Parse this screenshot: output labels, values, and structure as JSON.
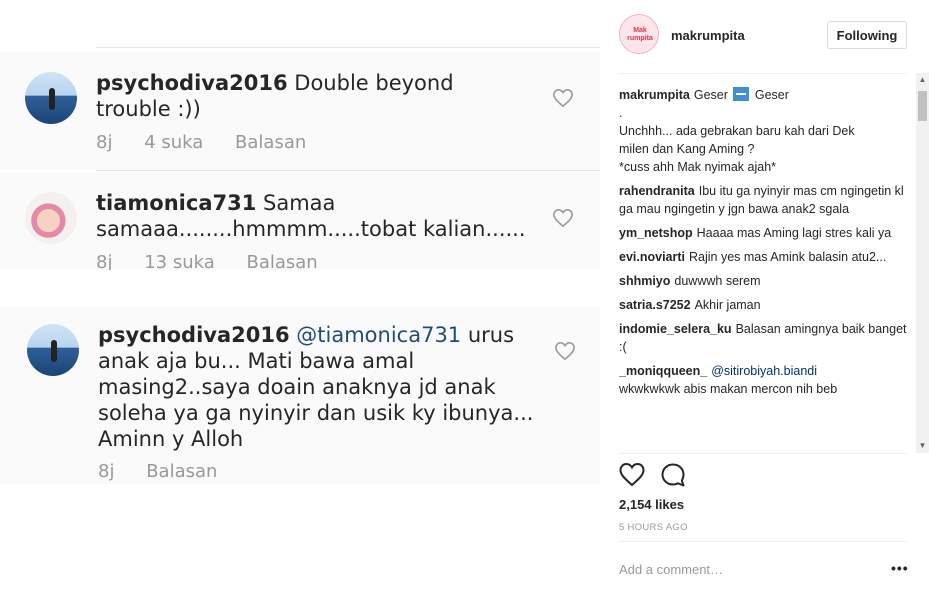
{
  "image_comments": [
    {
      "username": "psychodiva2016",
      "text_line1": "Double beyond",
      "text_line2": "trouble :))",
      "time": "8j",
      "likes": "4 suka",
      "reply": "Balasan"
    },
    {
      "username": "tiamonica731",
      "text_line1": "Samaa",
      "text_line2": "samaaa........hmmmm.....tobat kalian......",
      "time": "8j",
      "likes": "13 suka",
      "reply": "Balasan"
    },
    {
      "username": "psychodiva2016",
      "mention": "@tiamonica731",
      "text_line1": "urus",
      "text_line2": "anak aja bu... Mati bawa amal",
      "text_line3": "masing2..saya doain anaknya jd anak",
      "text_line4": "soleha ya ga nyinyir dan usik ky ibunya...",
      "text_line5": "Aminn y Alloh",
      "time": "8j",
      "reply": "Balasan"
    }
  ],
  "sidebar": {
    "avatar_text": "Mak rumpita",
    "username": "makrumpita",
    "follow_label": "Following",
    "caption": {
      "username": "makrumpita",
      "word1": "Geser",
      "word2": "Geser",
      "line_dot": ".",
      "line3": "Unchhh... ada gebrakan baru kah dari Dek",
      "line4": "milen dan Kang Aming ?",
      "line5": "*cuss ahh Mak nyimak ajah*"
    },
    "comments": [
      {
        "username": "rahendranita",
        "text": "Ibu itu ga nyinyir mas cm ngingetin kl ga mau ngingetin y jgn bawa anak2 sgala"
      },
      {
        "username": "ym_netshop",
        "text": "Haaaa mas Aming lagi stres kali ya"
      },
      {
        "username": "evi.noviarti",
        "text": "Rajin yes mas Amink balasin atu2..."
      },
      {
        "username": "shhmiyo",
        "text": "duwwwh serem"
      },
      {
        "username": "satria.s7252",
        "text": "Akhir jaman"
      },
      {
        "username": "indomie_selera_ku",
        "text": "Balasan amingnya baik banget :("
      },
      {
        "username": "_moniqqueen_",
        "mention": "@sitirobiyah.biandi",
        "text": "wkwkwkwk abis makan mercon nih beb"
      }
    ],
    "likes": "2,154 likes",
    "time": "5 HOURS AGO",
    "add_comment_placeholder": "Add a comment…",
    "more": "•••"
  }
}
